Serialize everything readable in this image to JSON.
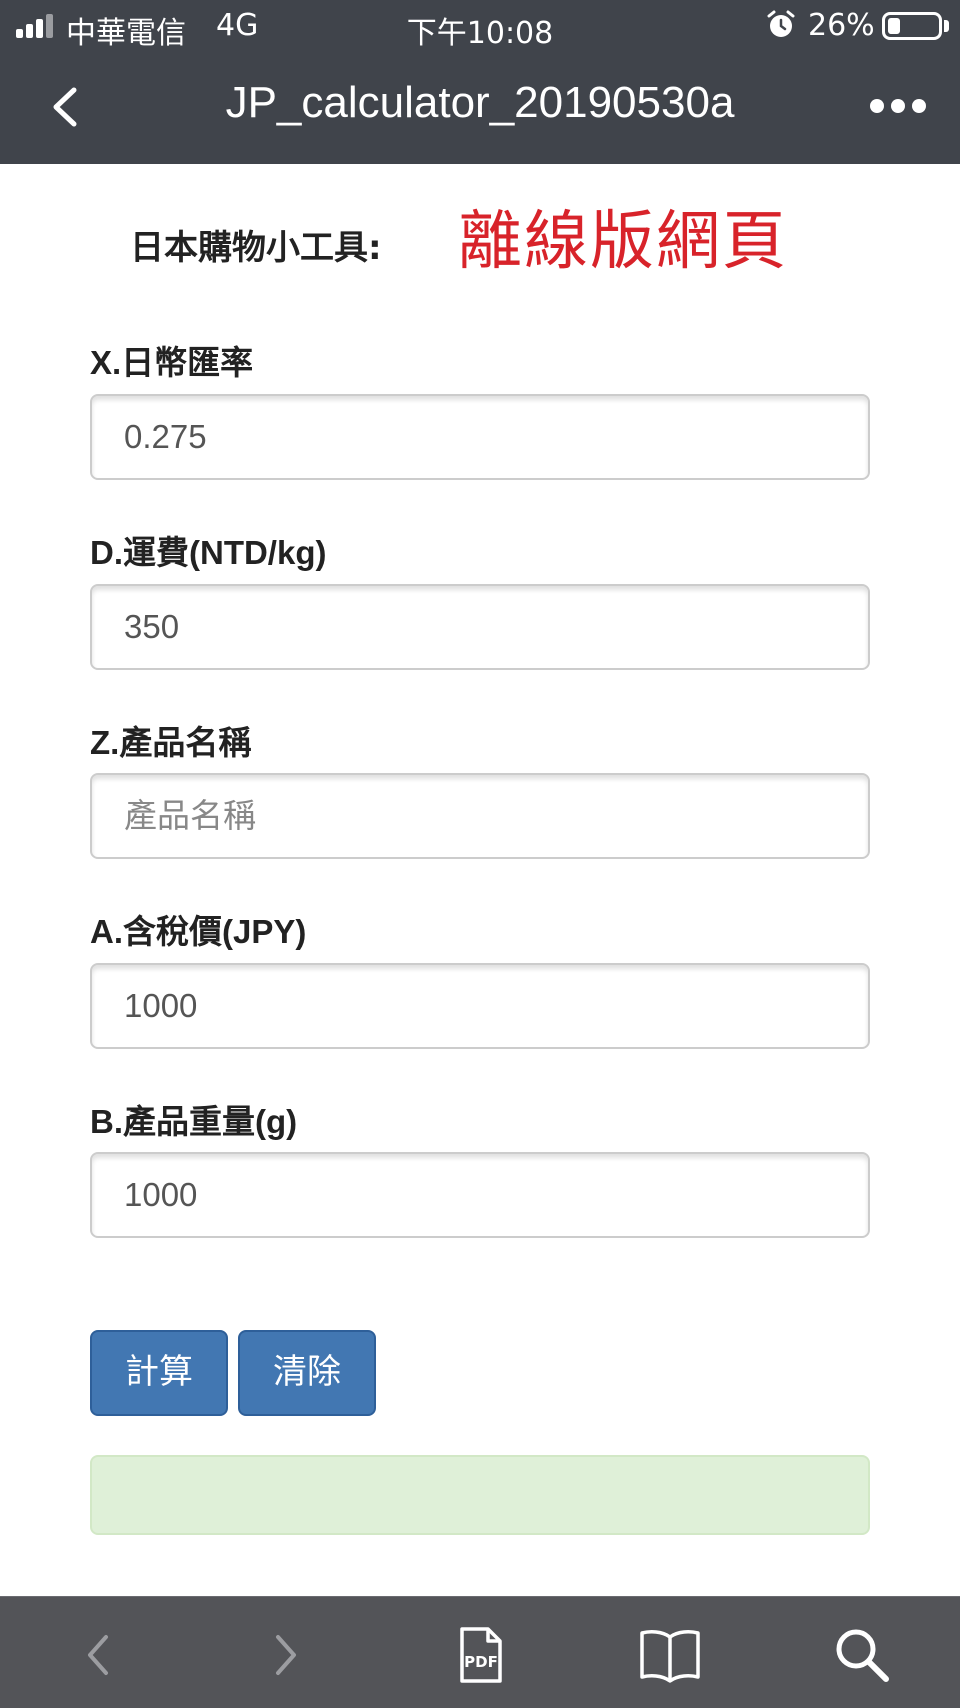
{
  "status_bar": {
    "carrier": "中華電信",
    "network": "4G",
    "time": "下午10:08",
    "battery_percent": "26%",
    "battery_level": 0.26
  },
  "nav": {
    "title": "JP_calculator_20190530a",
    "back_icon": "chevron-left-icon",
    "more_icon": "more-dots-icon"
  },
  "header": {
    "tool_title": "日本購物小工具:",
    "offline_title": "離線版網頁",
    "offline_color": "#d8232a"
  },
  "fields": [
    {
      "label": "X.日幣匯率",
      "value": "0.275",
      "placeholder": ""
    },
    {
      "label": "D.運費(NTD/kg)",
      "value": "350",
      "placeholder": ""
    },
    {
      "label": "Z.產品名稱",
      "value": "",
      "placeholder": "產品名稱"
    },
    {
      "label": "A.含稅價(JPY)",
      "value": "1000",
      "placeholder": ""
    },
    {
      "label": "B.產品重量(g)",
      "value": "1000",
      "placeholder": ""
    }
  ],
  "buttons": {
    "calculate": "計算",
    "clear": "清除"
  },
  "result": {
    "text": "",
    "background": "#dff0d8"
  },
  "toolbar": {
    "icons": [
      "back-arrow-icon",
      "forward-arrow-icon",
      "pdf-icon",
      "bookmarks-icon",
      "search-icon"
    ]
  },
  "colors": {
    "topbar": "#40444b",
    "button": "#4277b2",
    "toolbar": "#535458"
  }
}
